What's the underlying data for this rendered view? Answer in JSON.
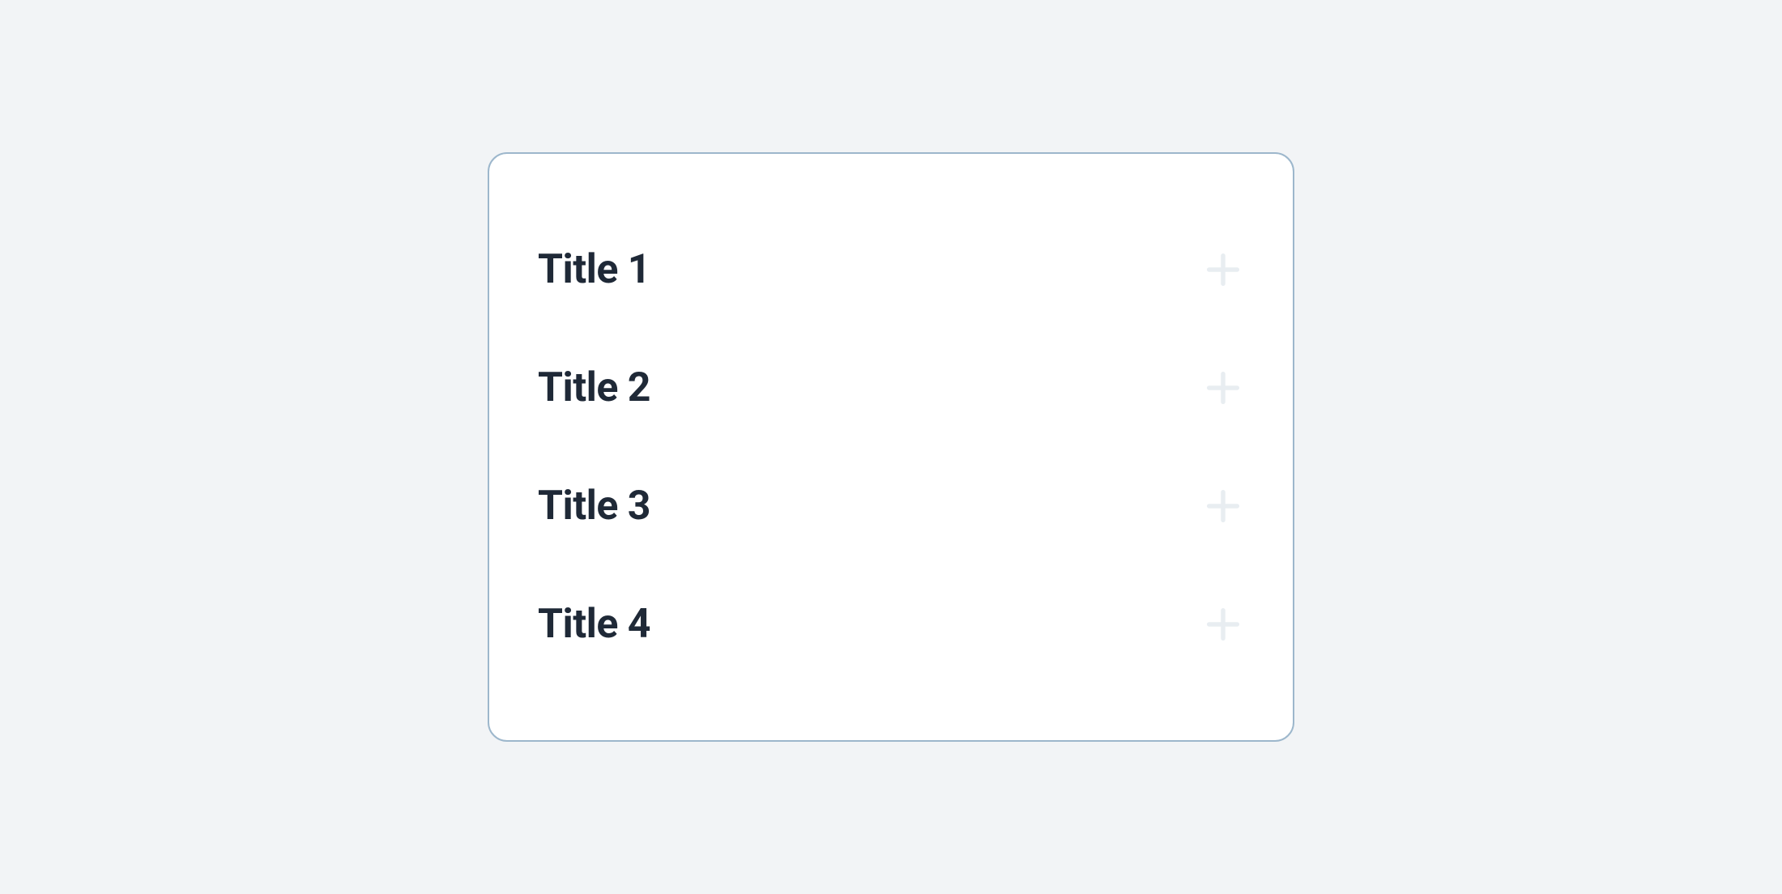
{
  "accordion": {
    "items": [
      {
        "title": "Title 1"
      },
      {
        "title": "Title 2"
      },
      {
        "title": "Title 3"
      },
      {
        "title": "Title 4"
      }
    ]
  }
}
